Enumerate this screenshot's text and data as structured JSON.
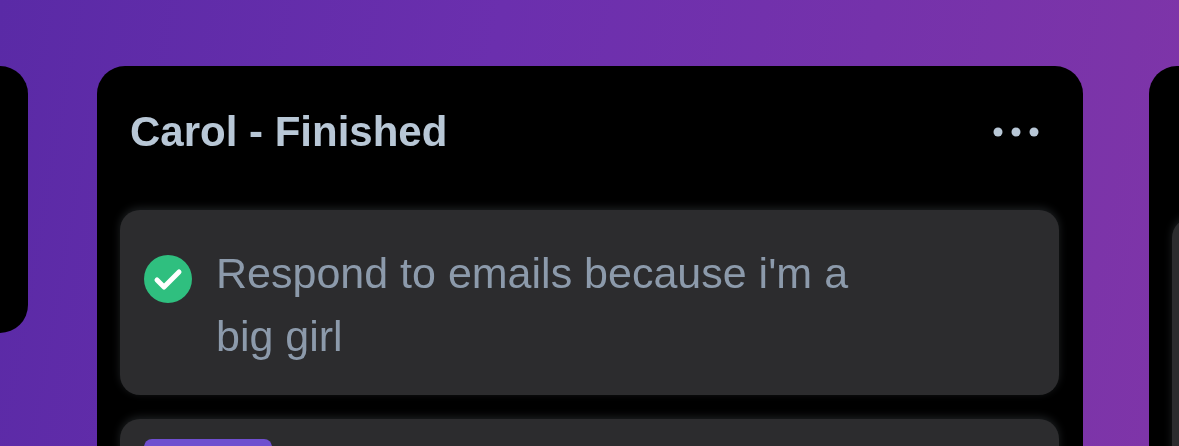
{
  "columns": [
    {
      "kind": "partial"
    },
    {
      "kind": "main",
      "title": "Carol - Finished",
      "cards": [
        {
          "text": "Respond to emails because i'm a big girl",
          "done": true
        },
        {
          "tags": [
            {
              "color": "#6f4fcf"
            }
          ]
        }
      ]
    },
    {
      "kind": "edge",
      "cards": [
        {
          "kind": "blank"
        }
      ]
    }
  ]
}
